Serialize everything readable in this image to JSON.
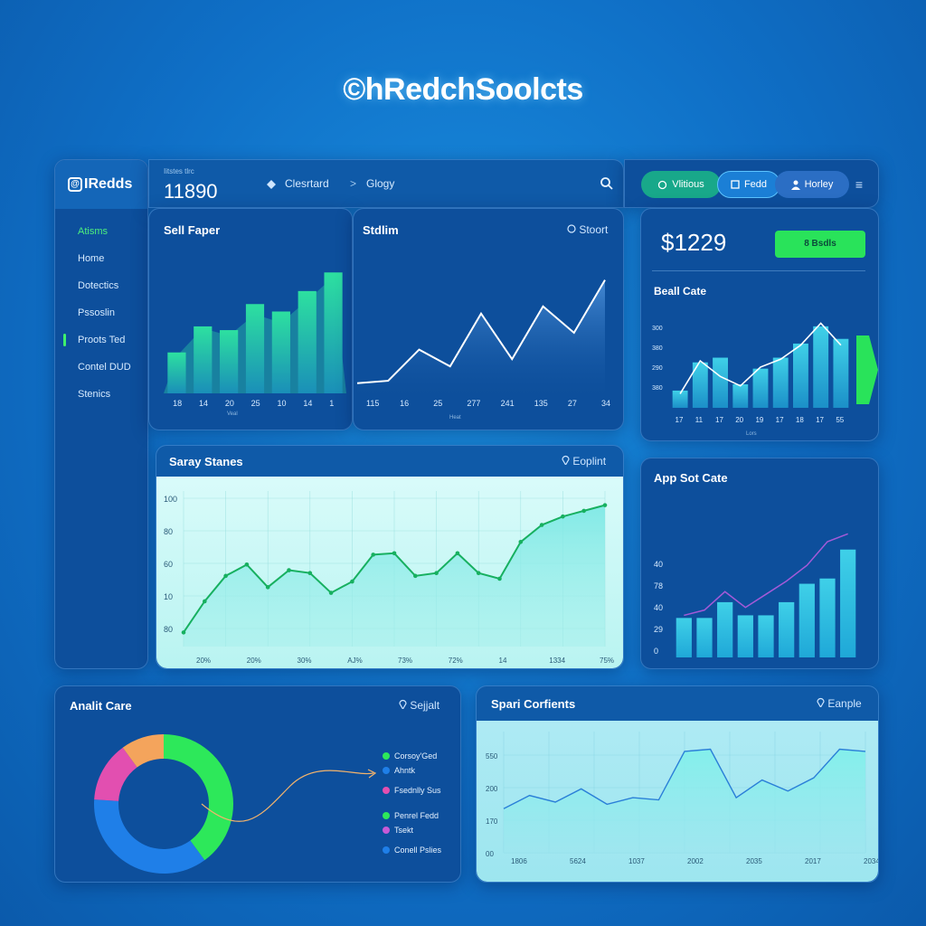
{
  "brand": {
    "title": "©hRedchSoolcts"
  },
  "colors": {
    "accent_green": "#3ff06c",
    "teal": "#1fbfd0",
    "panel": "#0d4f9c",
    "light_panel": "#9ef0ee"
  },
  "sidebar": {
    "logo": "IRedds",
    "items": [
      {
        "label": "Atisms",
        "active": true
      },
      {
        "label": "Home"
      },
      {
        "label": "Dotectics"
      },
      {
        "label": "Pssoslin"
      },
      {
        "label": "Proots Ted",
        "marked": true
      },
      {
        "label": "Contel DUD"
      },
      {
        "label": "Stenics"
      }
    ]
  },
  "topbar": {
    "kpi_caption": "Iitstes tlrc",
    "kpi_value": "11890",
    "crumb_1": "Clesrtard",
    "crumb_sep": ">",
    "crumb_2": "Glogy",
    "icons": {
      "crumb": "diamond-icon",
      "search": "search-icon"
    }
  },
  "tabs": [
    {
      "label": "Vlitious",
      "icon": "link-icon"
    },
    {
      "label": "Fedd",
      "icon": "book-icon"
    },
    {
      "label": "Horley",
      "icon": "user-icon"
    }
  ],
  "menu_icon": "≡",
  "balance": {
    "value": "$1229",
    "badge": "8 Bsdls"
  },
  "chart_data": [
    {
      "id": "sell_paper",
      "type": "bar",
      "title": "Sell Faper",
      "categories": [
        "18",
        "14",
        "20",
        "25",
        "10",
        "14",
        "1"
      ],
      "xlabel": "Veal",
      "values": [
        44,
        72,
        68,
        96,
        88,
        110,
        130
      ],
      "overlay_area": [
        40,
        70,
        62,
        85,
        76,
        100,
        125
      ],
      "ylim": [
        0,
        140
      ]
    },
    {
      "id": "stadium",
      "type": "area",
      "title": "Stdlim",
      "action": "Stoort",
      "x": [
        "115",
        "16",
        "25",
        "277",
        "241",
        "135",
        "27",
        "34"
      ],
      "xlabel": "Heat",
      "values": [
        10,
        12,
        38,
        24,
        68,
        30,
        74,
        52,
        96
      ],
      "ylim": [
        0,
        110
      ]
    },
    {
      "id": "ball_cate",
      "type": "bar",
      "title": "Beall Cate",
      "yticks": [
        "300",
        "380",
        "290",
        "380"
      ],
      "categories": [
        "17",
        "11",
        "17",
        "20",
        "19",
        "17",
        "18",
        "17",
        "55"
      ],
      "xlabel": "Lors",
      "values": [
        22,
        58,
        64,
        30,
        50,
        64,
        82,
        104,
        88
      ],
      "line": [
        18,
        60,
        40,
        28,
        52,
        62,
        80,
        108,
        80
      ],
      "ylim": [
        0,
        120
      ]
    },
    {
      "id": "saray_stanes",
      "type": "area",
      "title": "Saray Stanes",
      "action": "Eoplint",
      "yticks": [
        "100",
        "80",
        "60",
        "10",
        "80"
      ],
      "x": [
        "20%",
        "20%",
        "30%",
        "AJ%",
        "73%",
        "72%",
        "14",
        "1334",
        "75%"
      ],
      "values": [
        10,
        32,
        50,
        58,
        42,
        54,
        52,
        38,
        46,
        65,
        66,
        50,
        52,
        66,
        52,
        48,
        74,
        86,
        92,
        96,
        100
      ],
      "ylim": [
        0,
        110
      ]
    },
    {
      "id": "app_sot_cate",
      "type": "bar",
      "title": "App Sot Cate",
      "yticks": [
        "40",
        "78",
        "40",
        "29",
        "0"
      ],
      "values": [
        30,
        30,
        42,
        32,
        32,
        42,
        56,
        60,
        82
      ],
      "line": [
        32,
        36,
        50,
        38,
        48,
        58,
        70,
        88,
        94
      ],
      "ylim": [
        0,
        110
      ]
    },
    {
      "id": "analit_care",
      "type": "pie",
      "title": "Analit Care",
      "action": "Sejjalt",
      "slices": [
        {
          "label": "Corsoy'Ged",
          "value": 40,
          "color": "#2de85a"
        },
        {
          "label": "Ahntk",
          "value": 36,
          "color": "#1f7fe8"
        },
        {
          "label": "Fsednlly Sus",
          "value": 14,
          "color": "#e24fb0"
        },
        {
          "label": "Penrel Fedd",
          "value": 10,
          "color": "#f4a45c"
        }
      ],
      "legend": [
        {
          "label": "Corsoy'Ged",
          "color": "#2de85a"
        },
        {
          "label": "Ahntk",
          "color": "#1f7fe8"
        },
        {
          "label": "Fsednlly Sus",
          "color": "#e24fb0"
        },
        {
          "label": "Penrel Fedd",
          "color": "#2de85a"
        },
        {
          "label": "Tsekt",
          "color": "#c65ad6"
        },
        {
          "label": "Conell Pslies",
          "color": "#1f7fe8"
        }
      ]
    },
    {
      "id": "spari_contents",
      "type": "area",
      "title": "Spari Corfients",
      "action": "Eanple",
      "yticks": [
        "550",
        "200",
        "170",
        "00"
      ],
      "x": [
        "1806",
        "5624",
        "1037",
        "2002",
        "2035",
        "2017",
        "2034"
      ],
      "values": [
        40,
        52,
        46,
        58,
        44,
        50,
        48,
        92,
        94,
        50,
        66,
        56,
        68,
        94,
        92
      ],
      "ylim": [
        0,
        110
      ]
    }
  ]
}
